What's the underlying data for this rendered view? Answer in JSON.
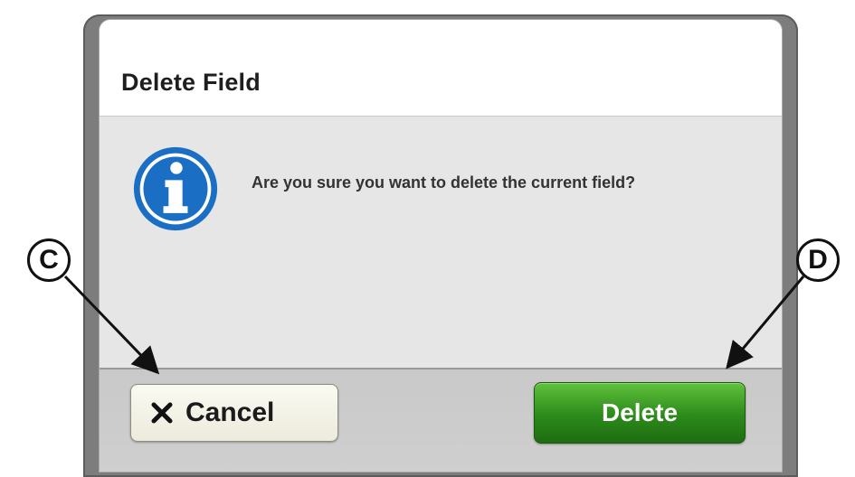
{
  "dialog": {
    "title": "Delete Field",
    "message": "Are you sure you want to delete the current field?",
    "icon": "info-icon"
  },
  "buttons": {
    "cancel_label": "Cancel",
    "cancel_icon": "close-icon",
    "delete_label": "Delete"
  },
  "callouts": {
    "cancel_marker": "C",
    "delete_marker": "D"
  },
  "colors": {
    "delete_button": "#2c8a1b",
    "info_icon": "#1a6fc4"
  }
}
